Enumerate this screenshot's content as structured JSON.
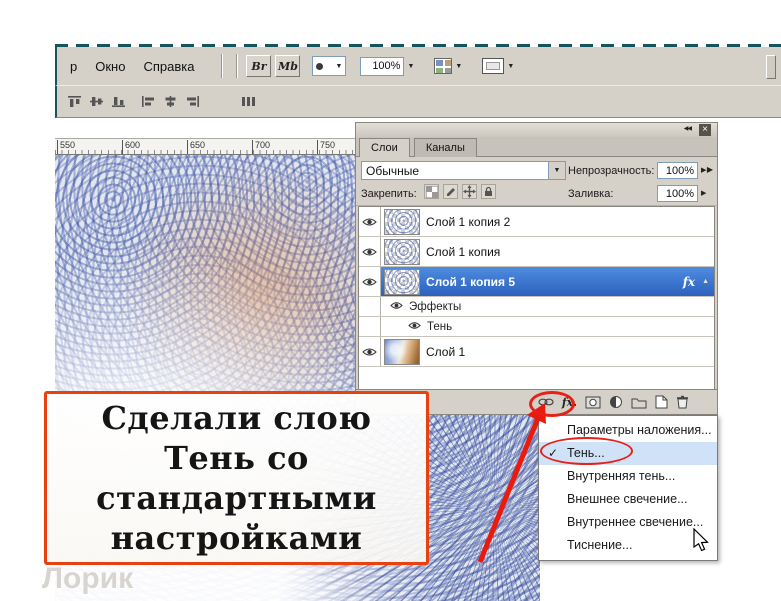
{
  "window": {
    "menu_items": [
      "р",
      "Окно",
      "Справка"
    ],
    "toolbar": {
      "bridge_label": "Br",
      "mobile_label": "Mb",
      "zoom_value": "100%"
    }
  },
  "ruler": {
    "ticks": [
      "550",
      "600",
      "650",
      "700",
      "750"
    ]
  },
  "layers_panel": {
    "tabs": [
      {
        "label": "Слои"
      },
      {
        "label": "Каналы"
      }
    ],
    "blend_mode_value": "Обычные",
    "opacity_label": "Непрозрачность:",
    "opacity_value": "100%",
    "lock_label": "Закрепить:",
    "fill_label": "Заливка:",
    "fill_value": "100%",
    "layers": [
      {
        "name": "Слой 1 копия 2"
      },
      {
        "name": "Слой 1 копия"
      },
      {
        "name": "Слой 1 копия 5"
      },
      {
        "name": "Эффекты"
      },
      {
        "name": "Тень"
      },
      {
        "name": "Слой 1"
      }
    ],
    "fx_badge": "fx"
  },
  "style_menu": {
    "items": [
      {
        "label": "Параметры наложения..."
      },
      {
        "label": "Тень..."
      },
      {
        "label": "Внутренняя тень..."
      },
      {
        "label": "Внешнее свечение..."
      },
      {
        "label": "Внутреннее свечение..."
      },
      {
        "label": "Тиснение..."
      }
    ],
    "checked_item": "Тень..."
  },
  "caption": {
    "line1": "Сделали слою",
    "line2": "Тень со",
    "line3": "стандартными",
    "line4": "настройками"
  },
  "watermark": "Лорик",
  "icons": {
    "dropdown": "▼",
    "flyout": "▶",
    "spinner": "▶",
    "collapse": "◀◀",
    "close": "×",
    "check": "✓",
    "fx_footer": "fx.",
    "expander": "▲"
  },
  "colors": {
    "accent_red": "#e62117",
    "selection_blue": "#3a78d2",
    "menu_highlight": "#cfe2f7",
    "caption_border": "#e8400e"
  }
}
